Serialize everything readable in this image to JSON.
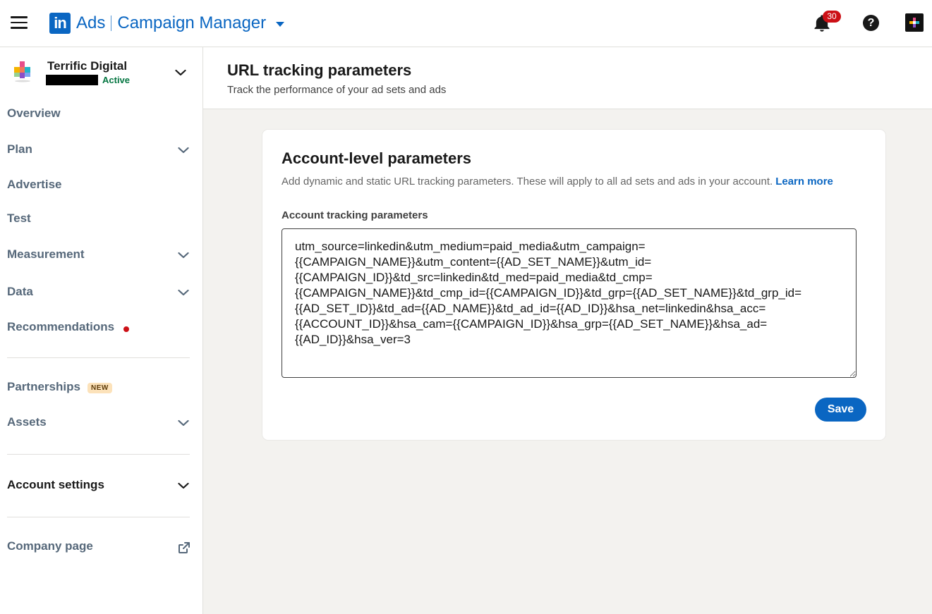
{
  "header": {
    "logo_text": "in",
    "product": "Ads",
    "app_name": "Campaign Manager",
    "notifications_count": "30",
    "help_glyph": "?"
  },
  "account": {
    "name": "Terrific Digital",
    "status": "Active"
  },
  "sidebar": {
    "items": [
      {
        "label": "Overview"
      },
      {
        "label": "Plan"
      },
      {
        "label": "Advertise"
      },
      {
        "label": "Test"
      },
      {
        "label": "Measurement"
      },
      {
        "label": "Data"
      },
      {
        "label": "Recommendations"
      },
      {
        "label": "Partnerships",
        "badge": "NEW"
      },
      {
        "label": "Assets"
      },
      {
        "label": "Account settings"
      },
      {
        "label": "Company page"
      }
    ]
  },
  "page": {
    "title": "URL tracking parameters",
    "subtitle": "Track the performance of your ad sets and ads"
  },
  "card": {
    "title": "Account-level parameters",
    "description": "Add dynamic and static URL tracking parameters. These will apply to all ad sets and ads in your account.",
    "learn_more": "Learn more",
    "field_label": "Account tracking parameters",
    "field_value": "utm_source=linkedin&utm_medium=paid_media&utm_campaign=\n{{CAMPAIGN_NAME}}&utm_content={{AD_SET_NAME}}&utm_id=\n{{CAMPAIGN_ID}}&td_src=linkedin&td_med=paid_media&td_cmp=\n{{CAMPAIGN_NAME}}&td_cmp_id={{CAMPAIGN_ID}}&td_grp={{AD_SET_NAME}}&td_grp_id=\n{{AD_SET_ID}}&td_ad={{AD_NAME}}&td_ad_id={{AD_ID}}&hsa_net=linkedin&hsa_acc=\n{{ACCOUNT_ID}}&hsa_cam={{CAMPAIGN_ID}}&hsa_grp={{AD_SET_NAME}}&hsa_ad=\n{{AD_ID}}&hsa_ver=3",
    "save_label": "Save"
  },
  "icons": {
    "menu": "hamburger-icon",
    "notifications": "bell-icon",
    "help": "help-icon",
    "external": "external-link-icon",
    "chevron": "chevron-down-icon"
  },
  "colors": {
    "brand": "#0a66c2",
    "active_status": "#057642",
    "alert": "#cc1016",
    "new_badge_bg": "#fce2ba"
  }
}
